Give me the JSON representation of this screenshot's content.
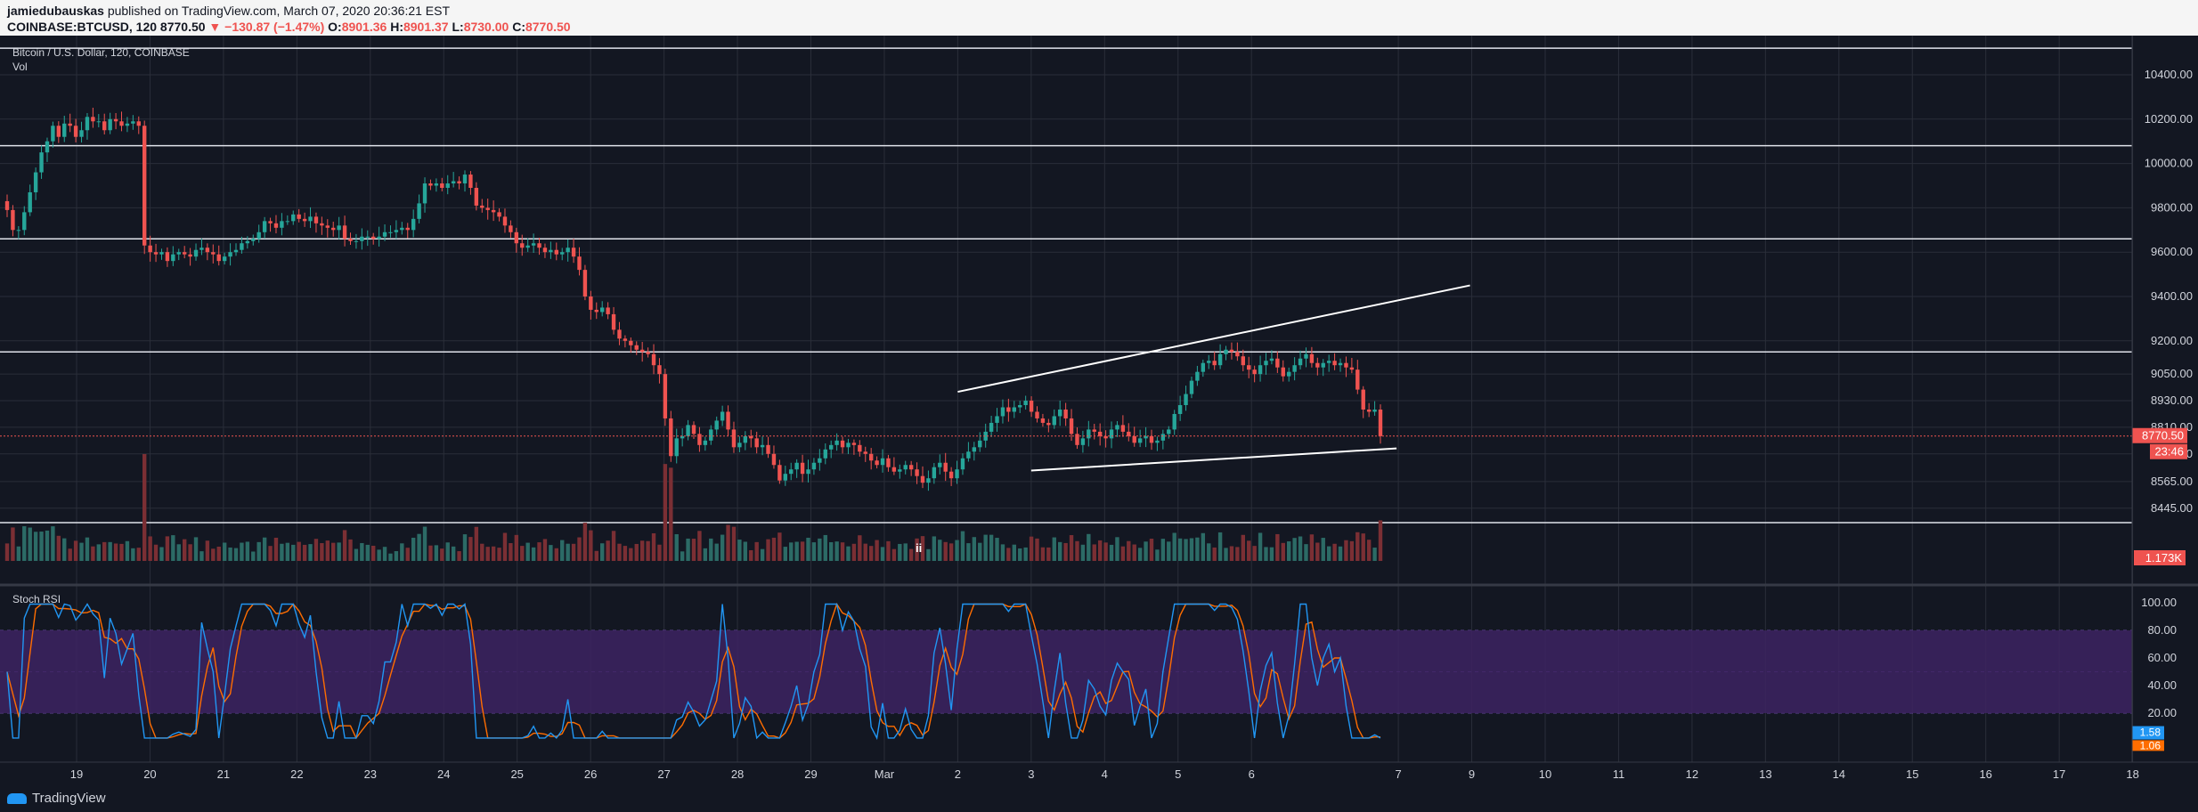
{
  "header": {
    "author": "jamiedubauskas",
    "published": "published on TradingView.com, March 07, 2020 20:36:21 EST",
    "symbol": "COINBASE:BTCUSD, 120",
    "last": "8770.50",
    "change": "▼ −130.87 (−1.47%)",
    "o_label": "O:",
    "o": "8901.36",
    "h_label": "H:",
    "h": "8901.37",
    "l_label": "L:",
    "l": "8730.00",
    "c_label": "C:",
    "c": "8770.50"
  },
  "pane_labels": {
    "main": "Bitcoin / U.S. Dollar, 120, COINBASE",
    "vol": "Vol",
    "stoch": "Stoch RSI",
    "marker": "ii"
  },
  "footer": {
    "brand": "TradingView"
  },
  "colors": {
    "bg": "#131722",
    "grid": "#2a2e39",
    "up": "#26a69a",
    "down": "#ef5350",
    "vol_up": "#2c6b66",
    "vol_down": "#7b2f34",
    "axis_text": "#d1d4dc",
    "stoch_k": "#2196f3",
    "stoch_d": "#ff6d00",
    "band": "#3d2361",
    "last_price": "#ef5350"
  },
  "chart_data": {
    "type": "candlestick",
    "price_axis_ticks": [
      "10400.00",
      "10200.00",
      "10000.00",
      "9800.00",
      "9600.00",
      "9400.00",
      "9200.00",
      "9050.00",
      "8930.00",
      "8810.00",
      "8690.00",
      "8565.00",
      "8445.00"
    ],
    "time_axis_ticks": [
      "19",
      "20",
      "21",
      "22",
      "23",
      "24",
      "25",
      "26",
      "27",
      "28",
      "29",
      "Mar",
      "2",
      "3",
      "4",
      "5",
      "6",
      "7",
      "9",
      "10",
      "11",
      "12",
      "13",
      "14",
      "15",
      "16",
      "17",
      "18"
    ],
    "last_price_label": "8770.50",
    "countdown_label": "23:46",
    "volume_label": "1.173K",
    "stoch_axis_ticks": [
      "100.00",
      "80.00",
      "60.00",
      "40.00",
      "20.00"
    ],
    "stoch_k_label": "1.58",
    "stoch_d_label": "1.06",
    "horizontal_levels": [
      10520,
      10080,
      9660,
      9150,
      8380
    ],
    "trendlines": [
      {
        "from": [
          "Mar 2",
          8970
        ],
        "to": [
          "Mar 9",
          9450
        ]
      },
      {
        "from": [
          "Mar 3",
          8615
        ],
        "to": [
          "Mar 8",
          8715
        ]
      }
    ],
    "close_series": [
      9790,
      9700,
      9700,
      9780,
      9870,
      9960,
      10050,
      10100,
      10170,
      10120,
      10180,
      10170,
      10120,
      10150,
      10210,
      10190,
      10190,
      10150,
      10200,
      10190,
      10170,
      10180,
      10190,
      10170,
      9630,
      9600,
      9590,
      9600,
      9560,
      9590,
      9600,
      9590,
      9580,
      9610,
      9620,
      9600,
      9590,
      9560,
      9580,
      9600,
      9610,
      9640,
      9650,
      9660,
      9690,
      9740,
      9730,
      9710,
      9740,
      9740,
      9770,
      9750,
      9740,
      9760,
      9730,
      9720,
      9710,
      9700,
      9720,
      9660,
      9650,
      9650,
      9670,
      9670,
      9660,
      9670,
      9690,
      9690,
      9700,
      9710,
      9700,
      9750,
      9820,
      9910,
      9900,
      9910,
      9890,
      9910,
      9920,
      9910,
      9950,
      9890,
      9810,
      9800,
      9790,
      9780,
      9760,
      9720,
      9690,
      9640,
      9620,
      9630,
      9640,
      9620,
      9600,
      9610,
      9590,
      9600,
      9620,
      9580,
      9520,
      9400,
      9340,
      9330,
      9350,
      9320,
      9250,
      9210,
      9200,
      9180,
      9160,
      9150,
      9140,
      9090,
      9050,
      8850,
      8680,
      8760,
      8770,
      8820,
      8780,
      8730,
      8750,
      8800,
      8840,
      8880,
      8800,
      8720,
      8740,
      8770,
      8760,
      8720,
      8730,
      8690,
      8640,
      8570,
      8600,
      8620,
      8650,
      8600,
      8620,
      8650,
      8670,
      8710,
      8730,
      8750,
      8720,
      8740,
      8730,
      8700,
      8690,
      8660,
      8640,
      8670,
      8630,
      8610,
      8620,
      8640,
      8620,
      8590,
      8560,
      8580,
      8630,
      8650,
      8610,
      8580,
      8620,
      8670,
      8700,
      8720,
      8750,
      8790,
      8830,
      8860,
      8900,
      8880,
      8900,
      8910,
      8930,
      8880,
      8850,
      8830,
      8820,
      8860,
      8890,
      8850,
      8780,
      8730,
      8760,
      8800,
      8790,
      8770,
      8760,
      8800,
      8820,
      8790,
      8770,
      8740,
      8760,
      8770,
      8740,
      8750,
      8780,
      8800,
      8870,
      8910,
      8960,
      9020,
      9060,
      9100,
      9110,
      9090,
      9140,
      9160,
      9150,
      9130,
      9090,
      9070,
      9050,
      9090,
      9110,
      9120,
      9080,
      9040,
      9060,
      9090,
      9120,
      9140,
      9100,
      9080,
      9100,
      9110,
      9090,
      9100,
      9080,
      9070,
      8980,
      8890,
      8880,
      8890,
      8770
    ],
    "volume_label_unit": "K"
  }
}
